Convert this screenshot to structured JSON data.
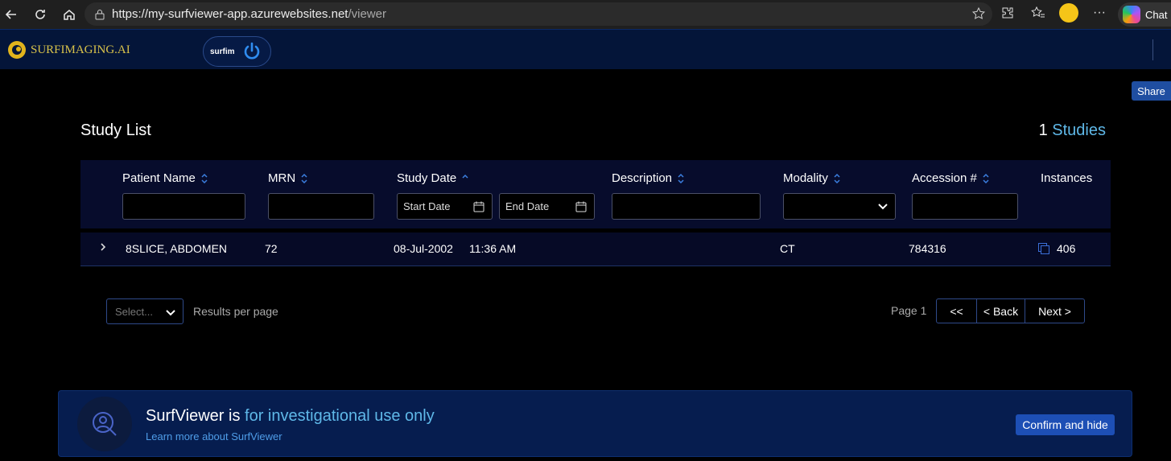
{
  "browser": {
    "url_host": "https://my-surfviewer-app.azurewebsites.net",
    "url_path": "/viewer",
    "chat_label": "Chat"
  },
  "app": {
    "logo_text": "SURFIMAGING.AI",
    "pill_label": "surfim",
    "share_label": "Share"
  },
  "study_list": {
    "title": "Study List",
    "count": "1",
    "count_label": "Studies",
    "columns": {
      "patient_name": "Patient Name",
      "mrn": "MRN",
      "study_date": "Study Date",
      "description": "Description",
      "modality": "Modality",
      "accession": "Accession #",
      "instances": "Instances"
    },
    "filters": {
      "start_date": "Start Date",
      "end_date": "End Date"
    },
    "rows": [
      {
        "patient_name": "8SLICE, ABDOMEN",
        "mrn": "72",
        "date": "08-Jul-2002",
        "time": "11:36 AM",
        "description": "",
        "modality": "CT",
        "accession": "784316",
        "instances": "406"
      }
    ]
  },
  "pagination": {
    "per_page_placeholder": "Select...",
    "per_page_label": "Results per page",
    "page_label": "Page 1",
    "first": "<<",
    "back": "< Back",
    "next": "Next >"
  },
  "banner": {
    "title_prefix": "SurfViewer is",
    "title_highlight": "for investigational use only",
    "link": "Learn more about SurfViewer",
    "confirm": "Confirm and hide"
  },
  "colors": {
    "accent": "#5fb8e8",
    "header_bg": "#041539",
    "button_blue": "#1d4fb5"
  }
}
